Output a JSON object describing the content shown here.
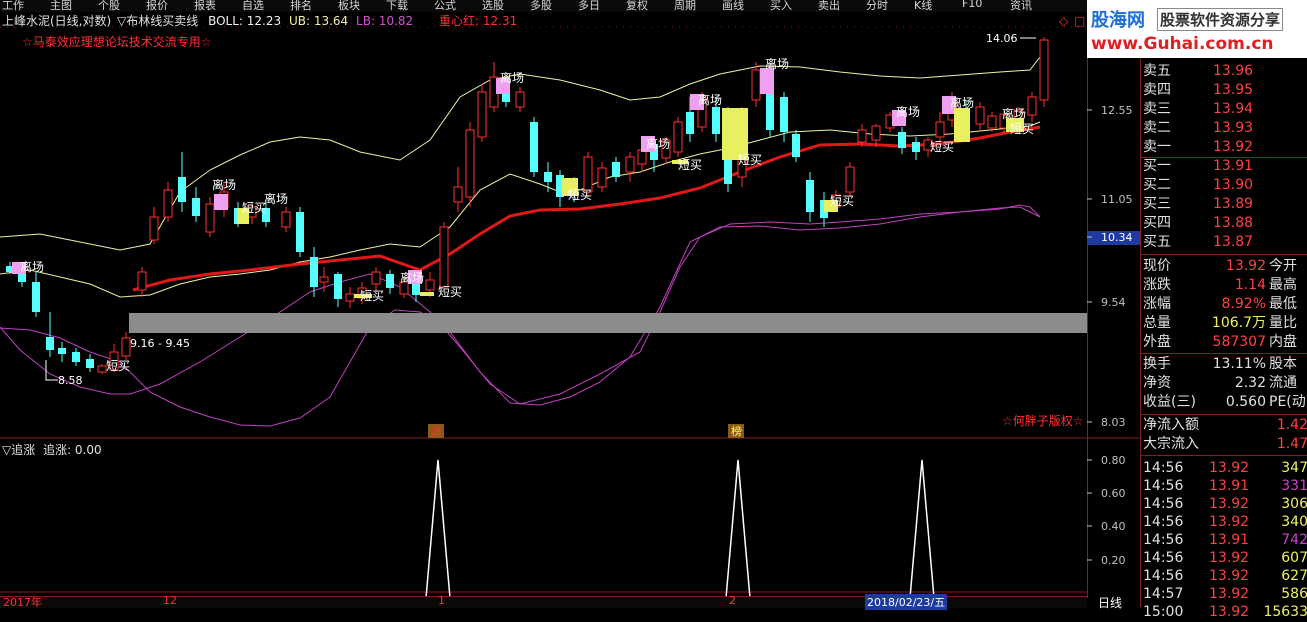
{
  "menu": [
    "工作",
    "主图",
    "个股",
    "报价",
    "报表",
    "自选",
    "排名",
    "板块",
    "下载",
    "公式",
    "选股",
    "多股",
    "多日",
    "复权",
    "周期",
    "画线",
    "买入",
    "卖出",
    "分时",
    "K线",
    "F10",
    "资讯"
  ],
  "main_chart": {
    "stock_name": "上峰水泥(日线,对数)",
    "indicator_name": "▽布林线买卖线",
    "boll_label": "BOLL: 12.23",
    "ub_label": "UB: 13.64",
    "lb_label": "LB: 10.82",
    "center_label": "重心红: 12.31",
    "notice": "☆马泰效应理想论坛技术交流专用☆",
    "copyright": "☆何胖子版权☆",
    "high_label": "14.06",
    "low_label": "8.58",
    "band_label": "9.16 - 9.45",
    "signal_sell": "离场",
    "signal_buy": "短买",
    "mark_zhang": "涨",
    "mark_bang": "榜",
    "price_axis": [
      "12.55",
      "11.05",
      "10.34",
      "9.54",
      "8.03"
    ]
  },
  "sub_chart": {
    "title": "▽追涨",
    "value_label": "追涨: 0.00",
    "axis": [
      "0.80",
      "0.60",
      "0.40",
      "0.20"
    ]
  },
  "time_axis": [
    "2017年",
    "12",
    "1",
    "2",
    "2018/02/23/五"
  ],
  "period_label": "日线",
  "logo": {
    "brand": "股海网",
    "slogan": "股票软件资源分享",
    "url": "www.Guhai.com.cn"
  },
  "quote": {
    "asks": [
      {
        "label": "卖五",
        "price": "13.96"
      },
      {
        "label": "卖四",
        "price": "13.95"
      },
      {
        "label": "卖三",
        "price": "13.94"
      },
      {
        "label": "卖二",
        "price": "13.93"
      },
      {
        "label": "卖一",
        "price": "13.92"
      }
    ],
    "bids": [
      {
        "label": "买一",
        "price": "13.91"
      },
      {
        "label": "买二",
        "price": "13.90"
      },
      {
        "label": "买三",
        "price": "13.89"
      },
      {
        "label": "买四",
        "price": "13.88"
      },
      {
        "label": "买五",
        "price": "13.87"
      }
    ],
    "stats": [
      {
        "label": "现价",
        "value": "13.92",
        "label2": "今开"
      },
      {
        "label": "涨跌",
        "value": "1.14",
        "label2": "最高"
      },
      {
        "label": "涨幅",
        "value": "8.92%",
        "label2": "最低"
      },
      {
        "label": "总量",
        "value": "106.7万",
        "label2": "量比"
      },
      {
        "label": "外盘",
        "value": "587307",
        "label2": "内盘"
      },
      {
        "label": "换手",
        "value": "13.11%",
        "label2": "股本"
      },
      {
        "label": "净资",
        "value": "2.32",
        "label2": "流通"
      },
      {
        "label": "收益(三)",
        "value": "0.560",
        "label2": "PE(动)"
      }
    ],
    "flows": [
      {
        "label": "净流入额",
        "value": "1.42"
      },
      {
        "label": "大宗流入",
        "value": "1.47"
      }
    ],
    "ticks": [
      {
        "time": "14:56",
        "price": "13.92",
        "vol": "347"
      },
      {
        "time": "14:56",
        "price": "13.91",
        "vol": "331"
      },
      {
        "time": "14:56",
        "price": "13.92",
        "vol": "306"
      },
      {
        "time": "14:56",
        "price": "13.92",
        "vol": "340"
      },
      {
        "time": "14:56",
        "price": "13.91",
        "vol": "742"
      },
      {
        "time": "14:56",
        "price": "13.92",
        "vol": "607"
      },
      {
        "time": "14:56",
        "price": "13.92",
        "vol": "627"
      },
      {
        "time": "14:57",
        "price": "13.92",
        "vol": "586"
      },
      {
        "time": "15:00",
        "price": "13.92",
        "vol": "15633"
      }
    ]
  },
  "colors": {
    "up": "#ff3030",
    "down": "#54ffff",
    "sell_block": "#f0a0f0",
    "buy_block": "#e8f060",
    "boll": "#f0f0a0",
    "lower": "#c040c0",
    "center": "#e01818"
  }
}
